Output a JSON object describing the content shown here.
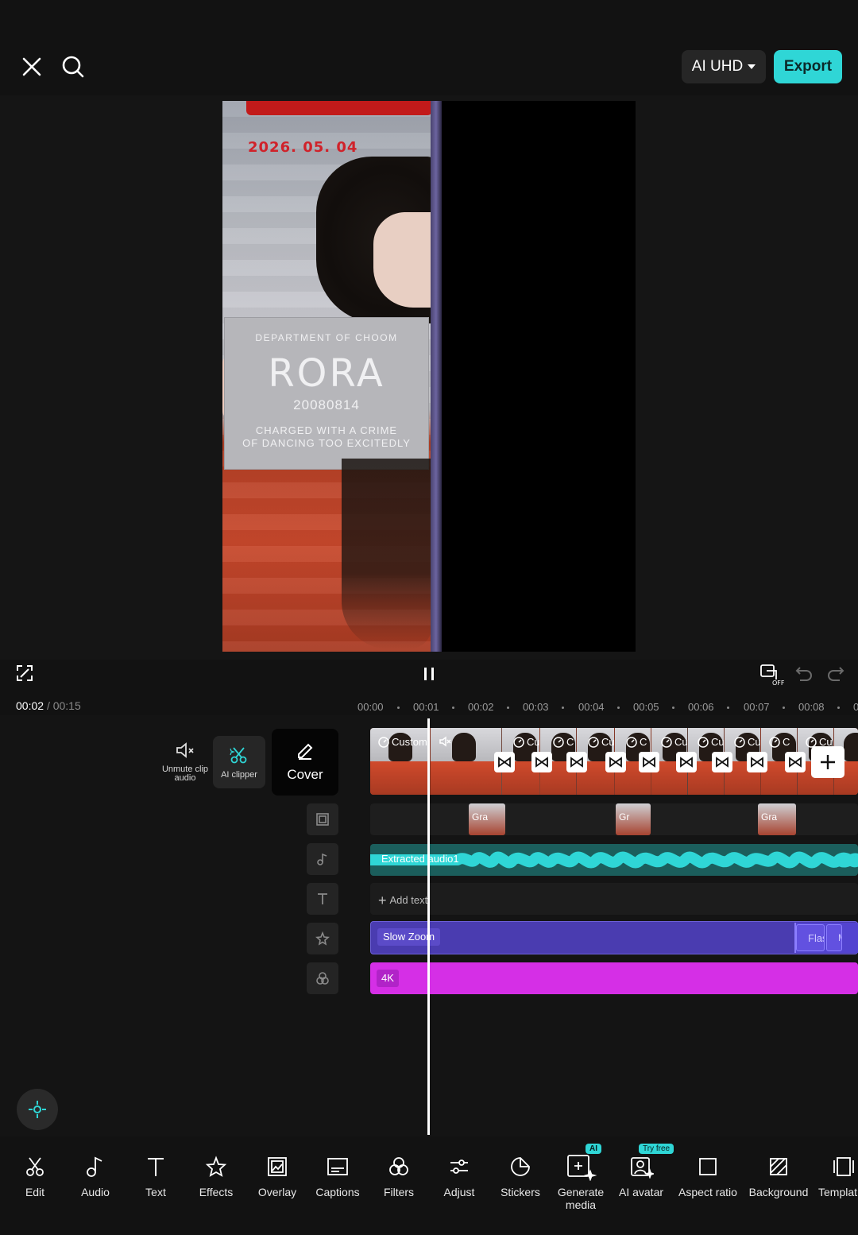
{
  "header": {
    "quality_label": "AI UHD",
    "export_label": "Export"
  },
  "preview": {
    "date_text": "2026. 05. 04",
    "board_line1": "DEPARTMENT OF CHOOM",
    "board_name": "RORA",
    "board_number": "20080814",
    "board_line3": "CHARGED WITH A CRIME",
    "board_line4": "OF DANCING TOO EXCITEDLY"
  },
  "playback": {
    "current_time": "00:02",
    "separator": "/",
    "total_time": "00:15"
  },
  "ruler": {
    "ticks": [
      "00:00",
      "00:01",
      "00:02",
      "00:03",
      "00:04",
      "00:05",
      "00:06",
      "00:07",
      "00:08",
      "0"
    ]
  },
  "clip_tools": {
    "unmute_label": "Unmute clip audio",
    "ai_clipper_label": "AI clipper",
    "cover_label": "Cover"
  },
  "tracks": {
    "video_clip_labels": [
      "Custom",
      "Cu",
      "C",
      "Cu",
      "C",
      "Cu",
      "Cu",
      "Cu",
      "C",
      "Cu",
      "Cu",
      "Cu"
    ],
    "overlay_labels": [
      "Gra",
      "Gr",
      "Gra"
    ],
    "audio_label": "Extracted audio1",
    "add_text_label": "Add text",
    "effect_label": "Slow Zoom",
    "effect_label2": "Flas",
    "effect_label3": "M",
    "filter_label": "4K"
  },
  "toolbar": {
    "items": [
      "Edit",
      "Audio",
      "Text",
      "Effects",
      "Overlay",
      "Captions",
      "Filters",
      "Adjust",
      "Stickers",
      "Generate media",
      "AI avatar",
      "Aspect ratio",
      "Background",
      "Templat"
    ],
    "ai_badge": "AI",
    "try_free_badge": "Try free"
  },
  "colors": {
    "accent": "#2fd6d6",
    "effect": "#4a3cb0",
    "filter": "#d52fe6",
    "audio": "#1b5e5c"
  }
}
